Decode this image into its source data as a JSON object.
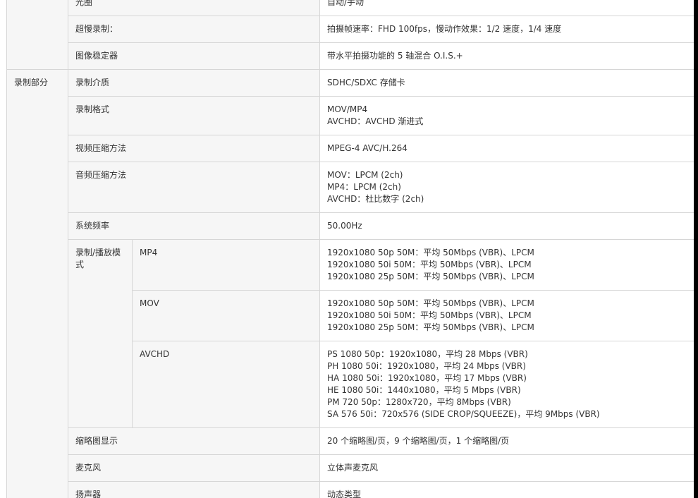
{
  "category": "录制部分",
  "rows": [
    {
      "label": "光圈",
      "value": [
        "自动/手动"
      ]
    },
    {
      "label": "超慢录制：",
      "value": [
        "拍摄帧速率：FHD 100fps，慢动作效果：1/2 速度，1/4 速度"
      ]
    },
    {
      "label": "图像稳定器",
      "value": [
        "带水平拍摄功能的 5 轴混合 O.I.S.+"
      ]
    },
    {
      "label": "录制介质",
      "value": [
        "SDHC/SDXC 存储卡"
      ]
    },
    {
      "label": "录制格式",
      "value": [
        "MOV/MP4",
        "AVCHD：AVCHD 渐进式"
      ]
    },
    {
      "label": "视频压缩方法",
      "value": [
        "MPEG-4 AVC/H.264"
      ]
    },
    {
      "label": "音频压缩方法",
      "value": [
        "MOV：LPCM (2ch)",
        "MP4：LPCM (2ch)",
        "AVCHD：杜比数字 (2ch)"
      ]
    },
    {
      "label": "系统频率",
      "value": [
        "50.00Hz"
      ]
    }
  ],
  "mode": {
    "label": "录制/播放模式",
    "subrows": [
      {
        "label": "MP4",
        "value": [
          "1920x1080 50p 50M：平均 50Mbps (VBR)、LPCM",
          "1920x1080 50i 50M：平均 50Mbps (VBR)、LPCM",
          "1920x1080 25p 50M：平均 50Mbps (VBR)、LPCM"
        ]
      },
      {
        "label": "MOV",
        "value": [
          "1920x1080 50p 50M：平均 50Mbps (VBR)、LPCM",
          "1920x1080 50i 50M：平均 50Mbps (VBR)、LPCM",
          "1920x1080 25p 50M：平均 50Mbps (VBR)、LPCM"
        ]
      },
      {
        "label": "AVCHD",
        "value": [
          "PS 1080 50p：1920x1080，平均 28 Mbps (VBR)",
          "PH 1080 50i：1920x1080，平均 24 Mbps (VBR)",
          "HA 1080 50i：1920x1080，平均 17 Mbps (VBR)",
          "HE 1080 50i：1440x1080，平均 5 Mbps (VBR)",
          "PM 720 50p：1280x720，平均 8Mbps (VBR)",
          "SA 576 50i：720x576 (SIDE CROP/SQUEEZE)，平均 9Mbps (VBR)"
        ]
      }
    ]
  },
  "rows_after": [
    {
      "label": "缩略图显示",
      "value": [
        "20 个缩略图/页，9 个缩略图/页，1 个缩略图/页"
      ]
    },
    {
      "label": "麦克风",
      "value": [
        "立体声麦克风"
      ]
    },
    {
      "label": "扬声器",
      "value": [
        "动态类型"
      ]
    }
  ]
}
